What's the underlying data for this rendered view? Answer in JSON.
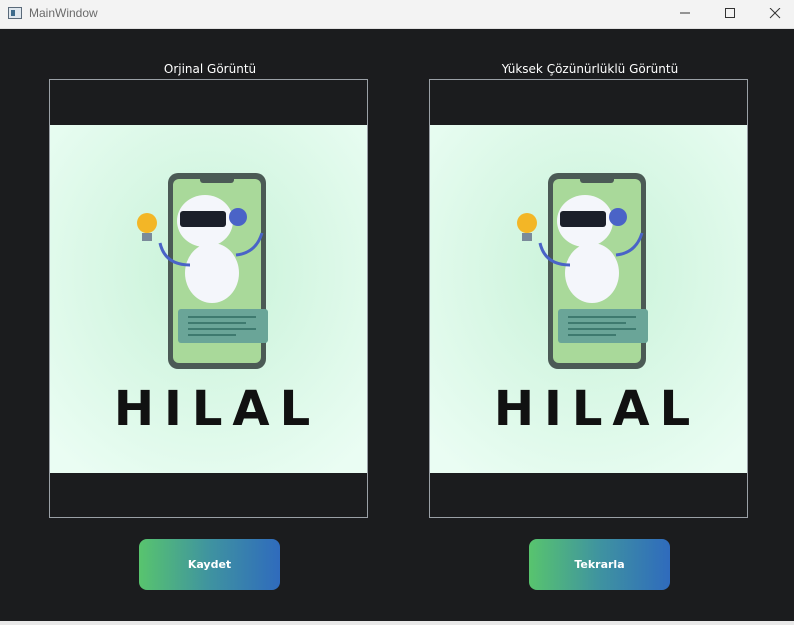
{
  "window": {
    "title": "MainWindow"
  },
  "panels": {
    "original_label": "Orjinal Görüntü",
    "highres_label": "Yüksek Çözünürlüklü Görüntü"
  },
  "image": {
    "caption": "HILAL"
  },
  "buttons": {
    "save": "Kaydet",
    "repeat": "Tekrarla"
  },
  "colors": {
    "background": "#1b1c1e",
    "button_start": "#58c46e",
    "button_end": "#2f6bbd"
  }
}
